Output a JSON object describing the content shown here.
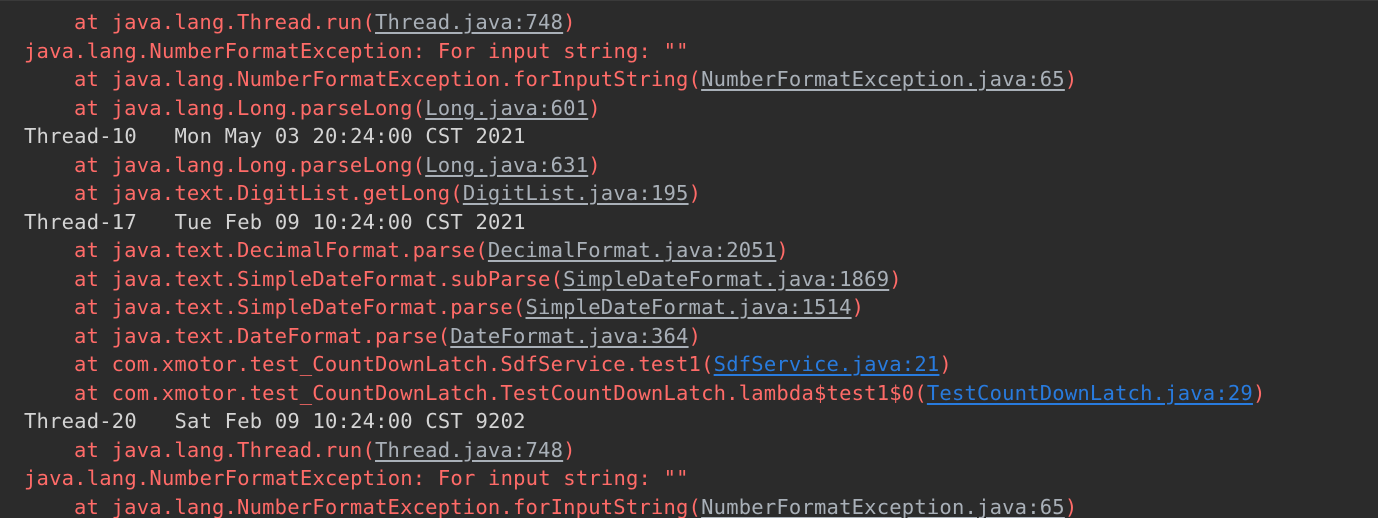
{
  "console": {
    "lines": [
      {
        "type": "frame",
        "prefix": "at java.lang.Thread.run(",
        "link": "Thread.java:748",
        "suffix": ")",
        "link_style": "gray"
      },
      {
        "type": "exception",
        "text": "java.lang.NumberFormatException: For input string: \"\""
      },
      {
        "type": "frame",
        "prefix": "at java.lang.NumberFormatException.forInputString(",
        "link": "NumberFormatException.java:65",
        "suffix": ")",
        "link_style": "gray"
      },
      {
        "type": "frame",
        "prefix": "at java.lang.Long.parseLong(",
        "link": "Long.java:601",
        "suffix": ")",
        "link_style": "gray"
      },
      {
        "type": "output",
        "text": "Thread-10   Mon May 03 20:24:00 CST 2021"
      },
      {
        "type": "frame",
        "prefix": "at java.lang.Long.parseLong(",
        "link": "Long.java:631",
        "suffix": ")",
        "link_style": "gray"
      },
      {
        "type": "frame",
        "prefix": "at java.text.DigitList.getLong(",
        "link": "DigitList.java:195",
        "suffix": ")",
        "link_style": "gray"
      },
      {
        "type": "output",
        "text": "Thread-17   Tue Feb 09 10:24:00 CST 2021"
      },
      {
        "type": "frame",
        "prefix": "at java.text.DecimalFormat.parse(",
        "link": "DecimalFormat.java:2051",
        "suffix": ")",
        "link_style": "gray"
      },
      {
        "type": "frame",
        "prefix": "at java.text.SimpleDateFormat.subParse(",
        "link": "SimpleDateFormat.java:1869",
        "suffix": ")",
        "link_style": "gray"
      },
      {
        "type": "frame",
        "prefix": "at java.text.SimpleDateFormat.parse(",
        "link": "SimpleDateFormat.java:1514",
        "suffix": ")",
        "link_style": "gray"
      },
      {
        "type": "frame",
        "prefix": "at java.text.DateFormat.parse(",
        "link": "DateFormat.java:364",
        "suffix": ")",
        "link_style": "gray"
      },
      {
        "type": "frame",
        "prefix": "at com.xmotor.test_CountDownLatch.SdfService.test1(",
        "link": "SdfService.java:21",
        "suffix": ")",
        "link_style": "blue"
      },
      {
        "type": "frame",
        "prefix": "at com.xmotor.test_CountDownLatch.TestCountDownLatch.lambda$test1$0(",
        "link": "TestCountDownLatch.java:29",
        "suffix": ")",
        "link_style": "blue"
      },
      {
        "type": "output",
        "text": "Thread-20   Sat Feb 09 10:24:00 CST 9202"
      },
      {
        "type": "frame",
        "prefix": "at java.lang.Thread.run(",
        "link": "Thread.java:748",
        "suffix": ")",
        "link_style": "gray"
      },
      {
        "type": "exception",
        "text": "java.lang.NumberFormatException: For input string: \"\""
      },
      {
        "type": "frame",
        "prefix": "at java.lang.NumberFormatException.forInputString(",
        "link": "NumberFormatException.java:65",
        "suffix": ")",
        "link_style": "gray"
      }
    ]
  },
  "colors": {
    "background": "#2b2b2b",
    "error_text": "#ff6b68",
    "output_text": "#d4d4d4",
    "link_gray": "#a9b0b8",
    "link_blue": "#287bde"
  }
}
